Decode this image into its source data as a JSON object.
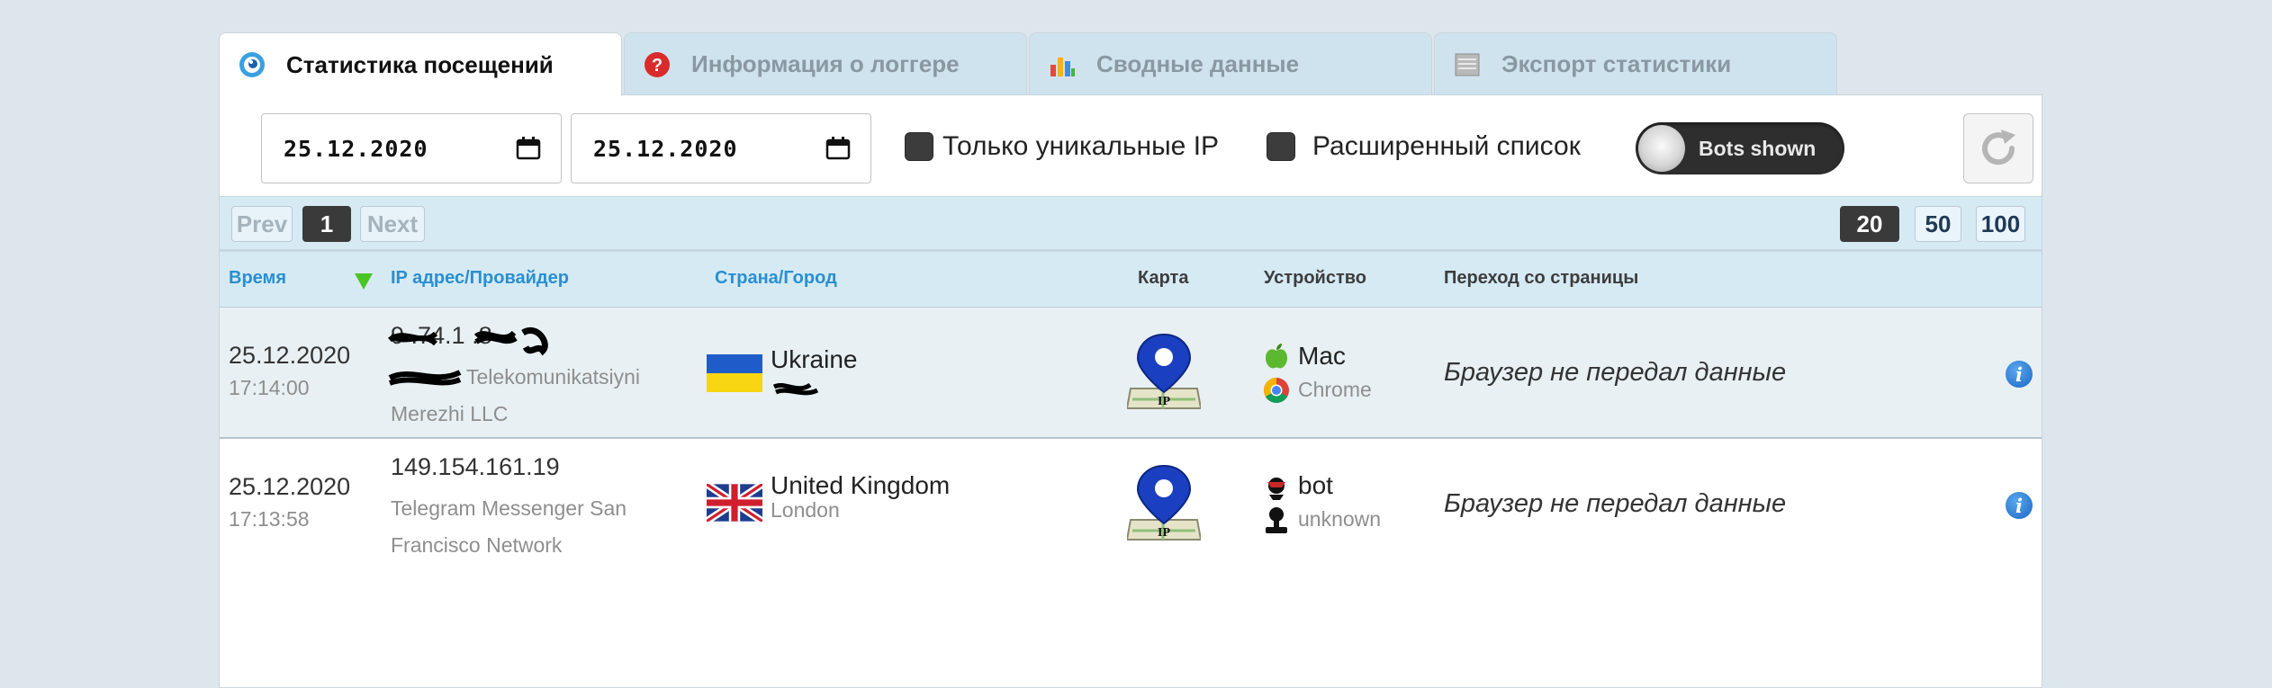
{
  "tabs": [
    {
      "label": "Статистика посещений",
      "icon": "eye-icon",
      "active": true
    },
    {
      "label": "Информация о логгере",
      "icon": "question-icon",
      "active": false
    },
    {
      "label": "Сводные данные",
      "icon": "bar-chart-icon",
      "active": false
    },
    {
      "label": "Экспорт статистики",
      "icon": "export-icon",
      "active": false
    }
  ],
  "filters": {
    "date_from": "25.12.2020",
    "date_to": "25.12.2020",
    "unique_ip_label": "Только уникальные IP",
    "extended_list_label": "Расширенный список",
    "bots_toggle_label": "Bots shown"
  },
  "pager": {
    "prev": "Prev",
    "current": "1",
    "next": "Next",
    "per_page": [
      "20",
      "50",
      "100"
    ],
    "per_page_selected": "20"
  },
  "columns": {
    "time": "Время",
    "ip": "IP адрес/Провайдер",
    "country": "Страна/Город",
    "map": "Карта",
    "device": "Устройство",
    "referrer": "Переход со страницы"
  },
  "rows": [
    {
      "date": "25.12.2020",
      "time": "17:14:00",
      "ip": "9 .74.1 .8",
      "provider": "Telekomunikatsiyni Merezhi LLC",
      "country": "Ukraine",
      "city": "",
      "flag": "ukraine-flag",
      "os": "Mac",
      "os_icon": "apple-icon",
      "browser": "Chrome",
      "browser_icon": "chrome-icon",
      "referrer": "Браузер не передал данные",
      "map_label": "IP"
    },
    {
      "date": "25.12.2020",
      "time": "17:13:58",
      "ip": "149.154.161.19",
      "provider": "Telegram Messenger San Francisco Network",
      "country": "United Kingdom",
      "city": "London",
      "flag": "uk-flag",
      "os": "bot",
      "os_icon": "bot-icon",
      "browser": "unknown",
      "browser_icon": "unknown-user-icon",
      "referrer": "Браузер не передал данные",
      "map_label": "IP"
    }
  ],
  "colors": {
    "background": "#dce6ec",
    "header_bg": "#d6eaf4",
    "link_blue": "#2a8fd0",
    "sort_arrow": "#4ac425"
  }
}
